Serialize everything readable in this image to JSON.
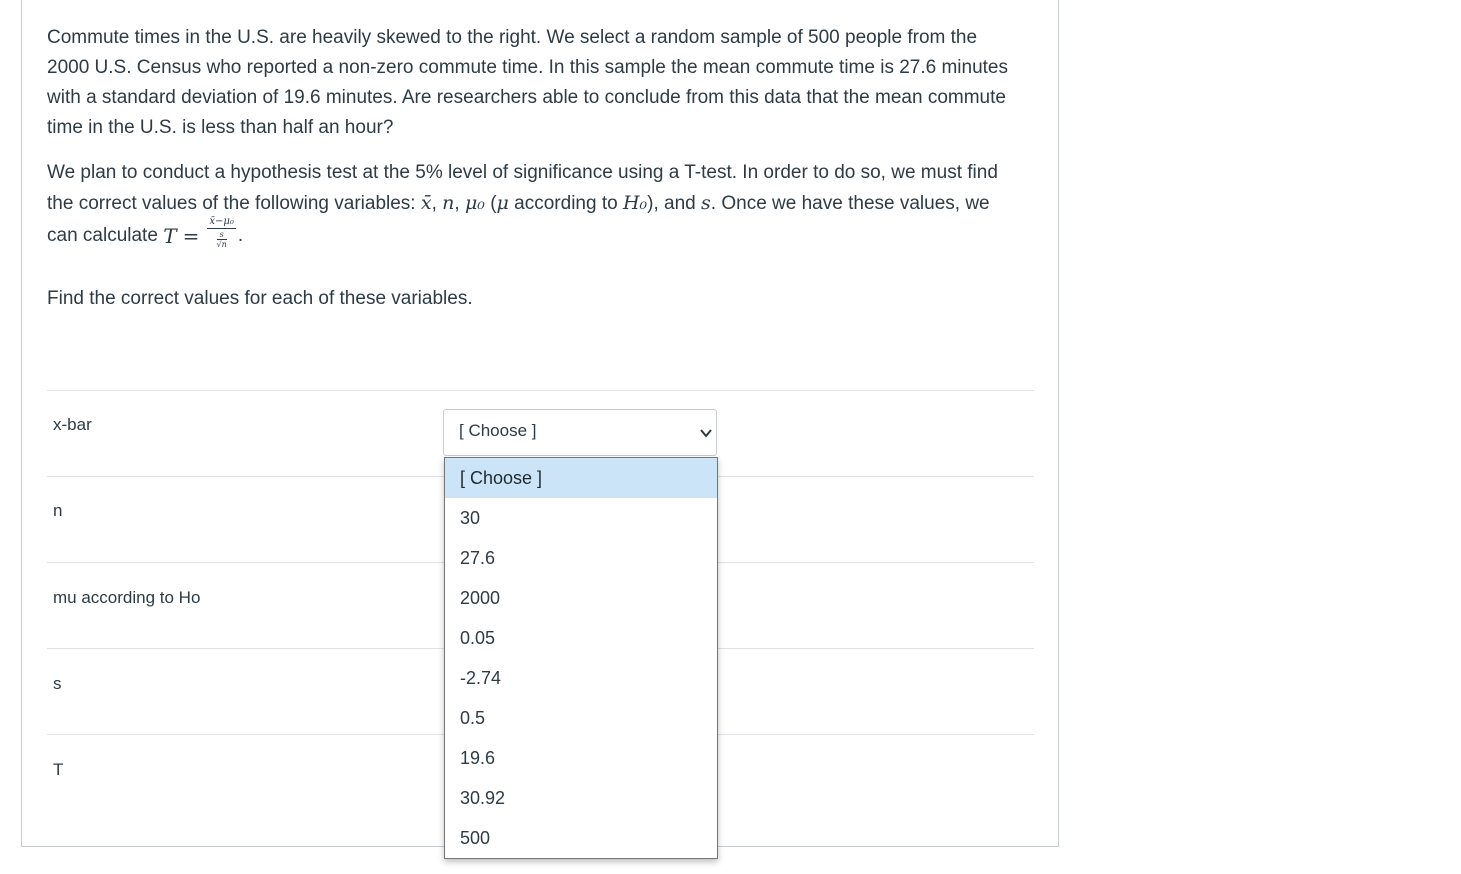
{
  "question": {
    "paragraph1": "Commute times in the U.S. are heavily skewed to the right. We select a random sample of 500 people from the 2000 U.S. Census who reported a non-zero commute time. In this sample the mean commute time is 27.6 minutes with a standard deviation of 19.6 minutes. Are researchers able to conclude from this data that the mean commute time in the U.S. is less than half an hour?",
    "paragraph2_part1": "We plan to conduct a hypothesis test at the 5% level of significance using a T-test. In order to do so, we must find the correct values of the following variables: ",
    "var_xbar": "x̄",
    "var_n": "n",
    "var_mu0": "μ₀",
    "paren_mu": "μ",
    "according_to": " according to ",
    "var_H0": "H₀",
    "and_text": "), and ",
    "var_s": "s",
    "paragraph2_part2": ". Once we have these values, we can calculate ",
    "formula_T": "T",
    "formula_eq": "=",
    "formula_num": "x̄−μ₀",
    "formula_den_s": "s",
    "formula_den_rootn": "√n",
    "paragraph3": "Find the correct values for each of these variables."
  },
  "rows": [
    {
      "label": "x-bar"
    },
    {
      "label": "n"
    },
    {
      "label": "mu according to Ho"
    },
    {
      "label": "s"
    },
    {
      "label": "T"
    }
  ],
  "select": {
    "value": "[ Choose ]",
    "options": [
      "[ Choose ]",
      "30",
      "27.6",
      "2000",
      "0.05",
      "-2.74",
      "0.5",
      "19.6",
      "30.92",
      "500"
    ]
  }
}
